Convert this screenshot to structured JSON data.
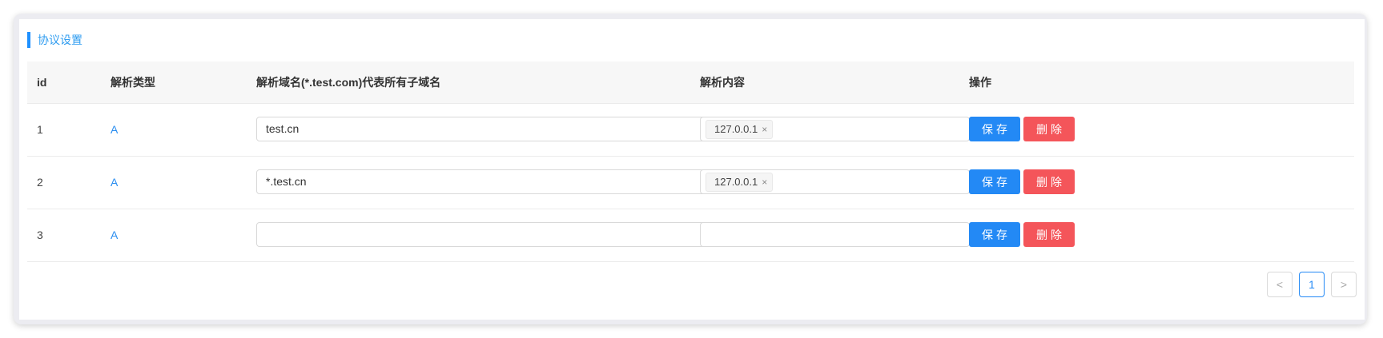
{
  "section_title": "协议设置",
  "table": {
    "headers": {
      "id": "id",
      "type": "解析类型",
      "domain": "解析域名(*.test.com)代表所有子域名",
      "content": "解析内容",
      "actions": "操作"
    },
    "rows": [
      {
        "id": "1",
        "type": "A",
        "domain": "test.cn",
        "content_tag": "127.0.0.1",
        "save": "保存",
        "delete": "删除"
      },
      {
        "id": "2",
        "type": "A",
        "domain": "*.test.cn",
        "content_tag": "127.0.0.1",
        "save": "保存",
        "delete": "删除"
      },
      {
        "id": "3",
        "type": "A",
        "domain": "",
        "content_tag": "",
        "save": "保存",
        "delete": "删除"
      }
    ]
  },
  "tag_close_symbol": "×",
  "pagination": {
    "prev": "<",
    "current": "1",
    "next": ">"
  },
  "colors": {
    "primary": "#2389f5",
    "danger": "#f4555a",
    "link": "#2b8ef0"
  }
}
